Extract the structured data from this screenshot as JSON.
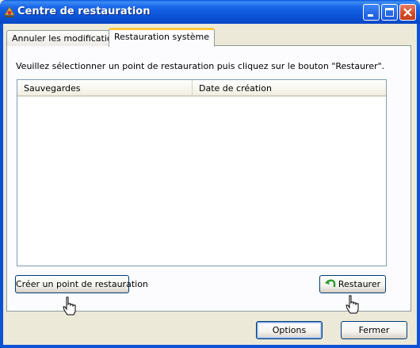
{
  "window": {
    "title": "Centre de restauration"
  },
  "tabs": [
    {
      "label": "Annuler les modifications",
      "active": false
    },
    {
      "label": "Restauration système",
      "active": true
    }
  ],
  "main": {
    "instructions": "Veuillez sélectionner un point de restauration puis cliquez sur le bouton \"Restaurer\".",
    "list": {
      "columns": [
        "Sauvegardes",
        "Date de création"
      ],
      "rows": []
    },
    "create_button": "Créer un point de restauration",
    "restore_button": "Restaurer"
  },
  "footer": {
    "options_button": "Options",
    "close_button": "Fermer"
  },
  "colors": {
    "titlebar": "#0a52d6",
    "tab_highlight": "#ffc83c",
    "button_border": "#003c74",
    "restore_arrow": "#2e9a2e"
  }
}
